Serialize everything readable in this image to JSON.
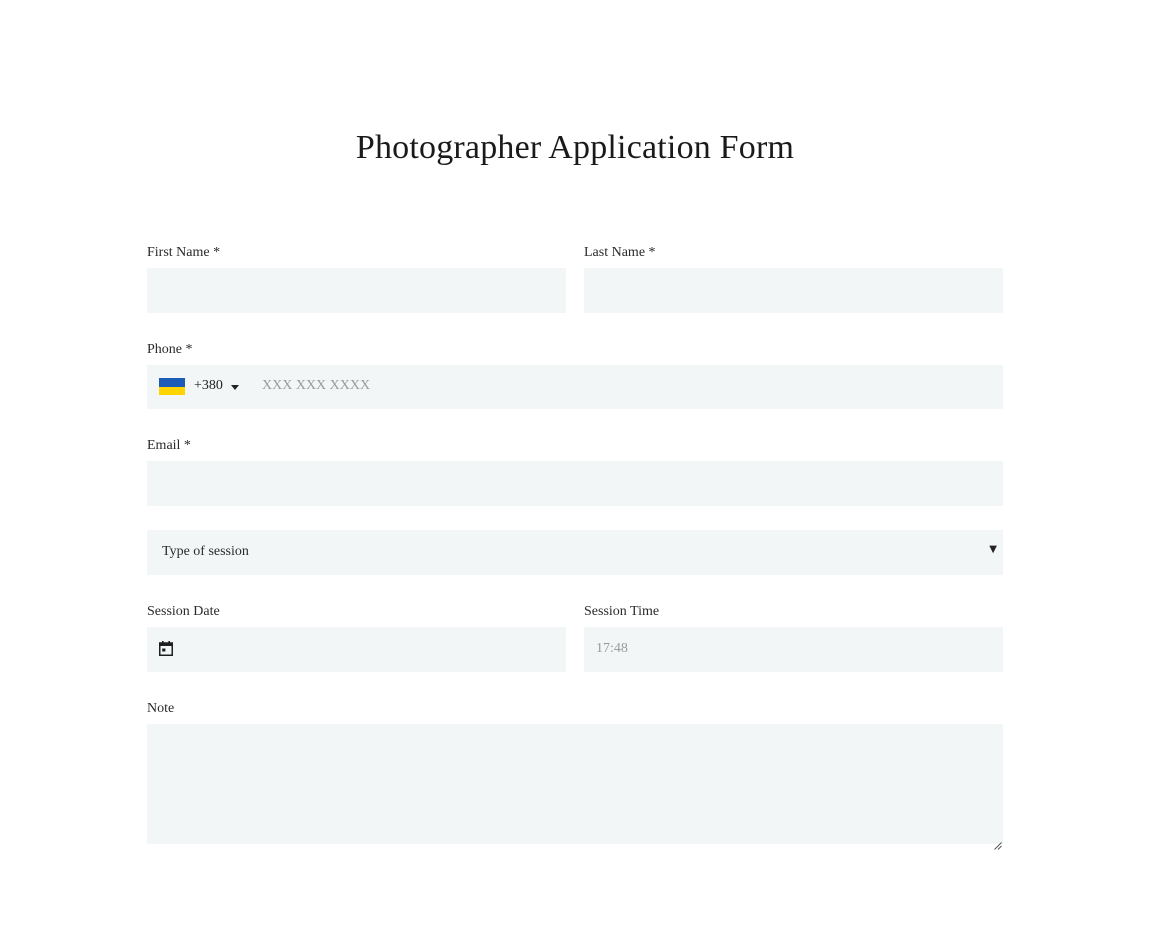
{
  "page": {
    "title": "Photographer Application Form"
  },
  "form": {
    "first_name": {
      "label": "First Name *",
      "value": ""
    },
    "last_name": {
      "label": "Last Name *",
      "value": ""
    },
    "phone": {
      "label": "Phone *",
      "dial_code": "+380",
      "country_flag": "ukraine-flag",
      "placeholder": "XXX XXX XXXX",
      "value": ""
    },
    "email": {
      "label": "Email *",
      "value": ""
    },
    "session_type": {
      "selected": "Type of session",
      "icon": "dropdown-arrow-icon"
    },
    "session_date": {
      "label": "Session Date",
      "icon": "calendar-icon",
      "value": ""
    },
    "session_time": {
      "label": "Session Time",
      "placeholder": "17:48",
      "value": ""
    },
    "note": {
      "label": "Note",
      "value": ""
    }
  },
  "colors": {
    "field_background": "#f3f6f7",
    "flag_blue": "#1c5bb8",
    "flag_yellow": "#ffd400"
  }
}
